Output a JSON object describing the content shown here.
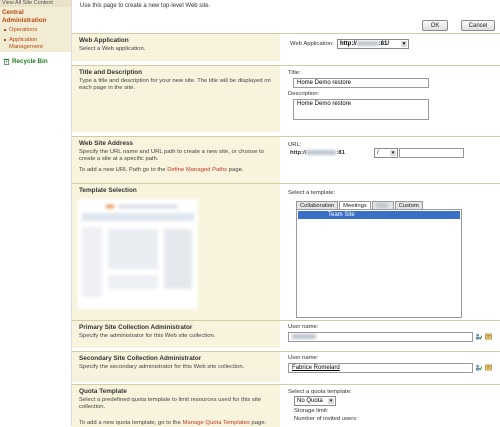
{
  "sidebar": {
    "top_link": "View All Site Content",
    "section_header": "Central Administration",
    "items": [
      "Operations",
      "Application Management"
    ],
    "recycle_bin": "Recycle Bin"
  },
  "page": {
    "intro": "Use this page to create a new top-level Web site.",
    "ok_label": "OK",
    "cancel_label": "Cancel"
  },
  "web_application": {
    "title": "Web Application",
    "description": "Select a Web application.",
    "field_label": "Web Application:",
    "value_prefix": "http://",
    "value_suffix": ":81/"
  },
  "title_description": {
    "title": "Title and Description",
    "description": "Type a title and description for your new site. The title will be displayed on each page in the site.",
    "title_label": "Title:",
    "title_value": "Home Demo restore",
    "desc_label": "Description:",
    "desc_value": "Home Demo restore"
  },
  "web_site_address": {
    "title": "Web Site Address",
    "description": "Specify the URL name and URL path to create a new site, or choose to create a site at a specific path.",
    "note_prefix": "To add a new URL Path go to the",
    "note_link": "Define Managed Paths",
    "note_suffix": "page.",
    "url_label": "URL:",
    "url_prefix": "http://",
    "url_port": ":81",
    "path_value": "/"
  },
  "template_selection": {
    "title": "Template Selection",
    "select_label": "Select a template:",
    "tabs": [
      "Collaboration",
      "Meetings",
      "",
      "Custom"
    ],
    "selected_template": "Team Site"
  },
  "primary_admin": {
    "title": "Primary Site Collection Administrator",
    "description": "Specify the administrator for this Web site collection.",
    "user_label": "User name:"
  },
  "secondary_admin": {
    "title": "Secondary Site Collection Administrator",
    "description": "Specify the secondary administrator for this Web site collection.",
    "user_label": "User name:",
    "user_value": "Fabrice Romelard"
  },
  "quota": {
    "title": "Quota Template",
    "description": "Select a predefined quota template to limit resources used for this site collection.",
    "note_prefix": "To add a new quota template, go to the",
    "note_link": "Manage Quota Templates",
    "note_suffix": "page.",
    "select_label": "Select a quota template:",
    "select_value": "No Quota",
    "storage_label": "Storage limit:",
    "users_label": "Number of invited users:"
  },
  "colors": {
    "accent": "#b8490f",
    "section_bg": "#f7f3dc",
    "selection": "#3a6fc6"
  }
}
